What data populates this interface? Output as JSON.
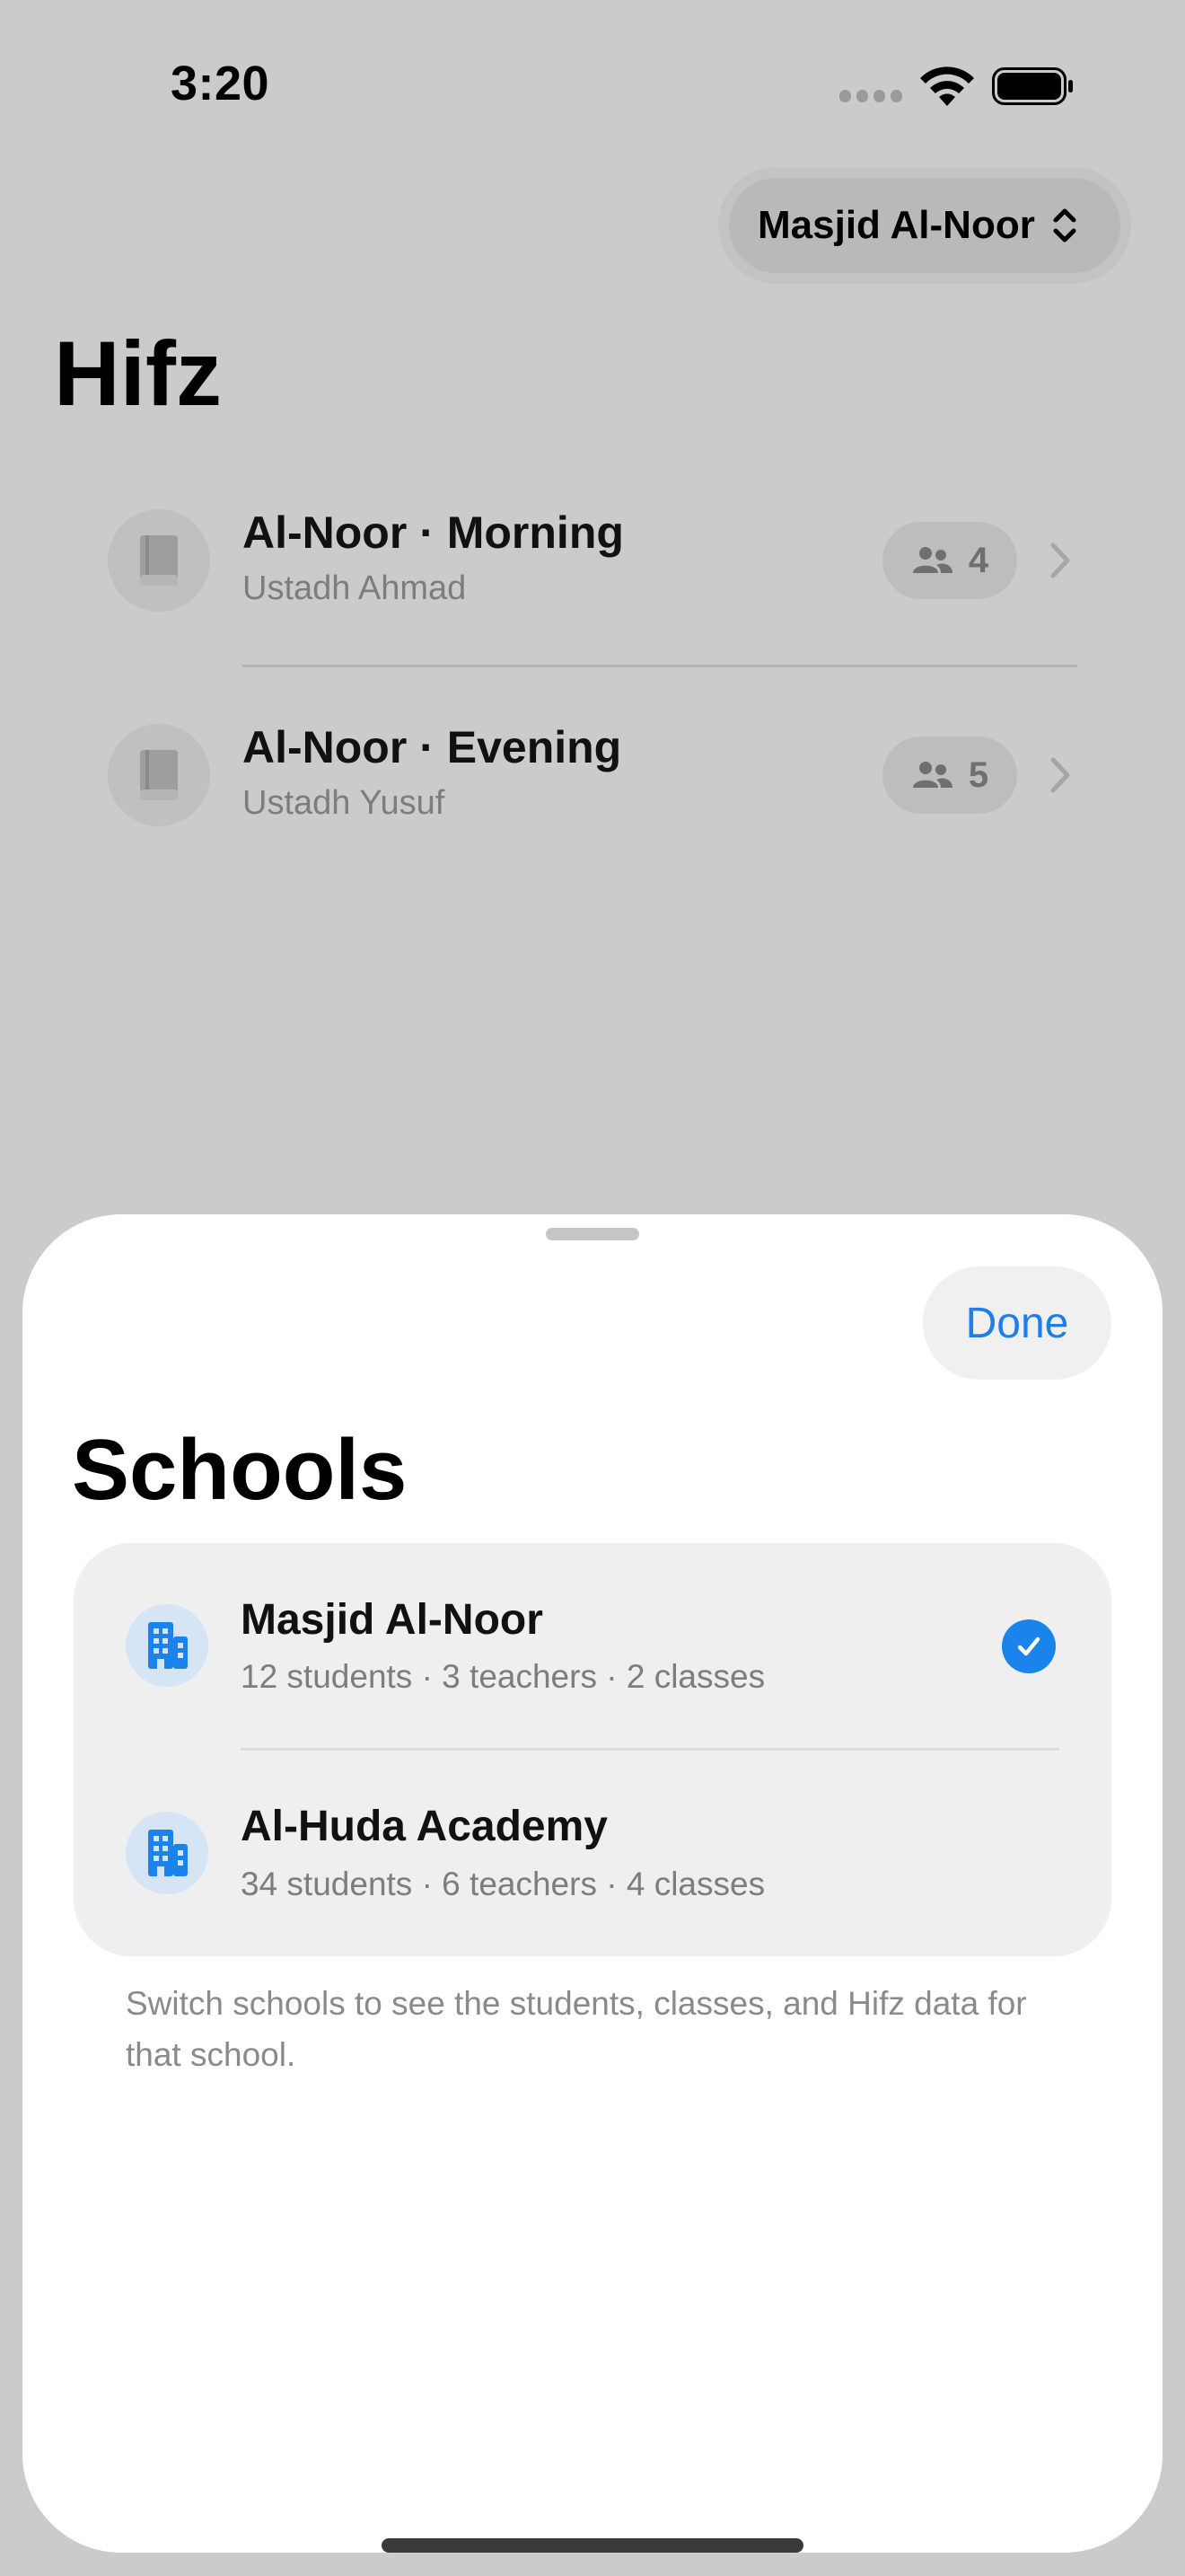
{
  "status_bar": {
    "time": "3:20",
    "icons": [
      "cellular-signal-icon",
      "wifi-icon",
      "battery-icon"
    ]
  },
  "header": {
    "school_picker_label": "Masjid Al-Noor",
    "page_title": "Hifz"
  },
  "classes": [
    {
      "name": "Al-Noor · Morning",
      "teacher": "Ustadh Ahmad",
      "student_count": "4",
      "icon": "book-icon"
    },
    {
      "name": "Al-Noor · Evening",
      "teacher": "Ustadh Yusuf",
      "student_count": "5",
      "icon": "book-icon"
    }
  ],
  "sheet": {
    "done_label": "Done",
    "title": "Schools",
    "schools": [
      {
        "name": "Masjid Al-Noor",
        "meta": "12 students · 3 teachers · 2 classes",
        "selected": true,
        "icon": "building-icon"
      },
      {
        "name": "Al-Huda Academy",
        "meta": "34 students · 6 teachers · 4 classes",
        "selected": false,
        "icon": "building-icon"
      }
    ],
    "footnote": "Switch schools to see the students, classes, and Hifz data for that school."
  },
  "colors": {
    "dimmed_background": "#cbcbcb",
    "accent": "#1a84ec",
    "sheet_background": "#ffffff",
    "card_background": "#efefef"
  }
}
